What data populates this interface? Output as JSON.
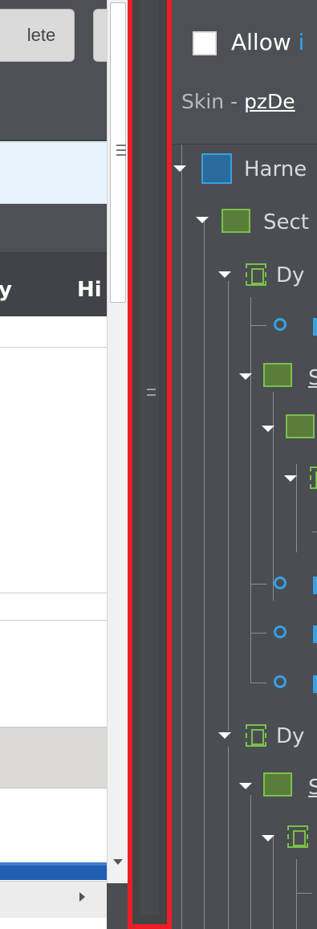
{
  "left_pane": {
    "toolbar": {
      "delete_button_label": "lete",
      "second_button_label": ""
    },
    "tabs": [
      {
        "label": "y"
      },
      {
        "label": "Hi"
      }
    ]
  },
  "splitter": {
    "grip_glyph": "="
  },
  "right_pane": {
    "allow_checkbox": {
      "checked": false,
      "label_visible": "Allow ",
      "label_highlight": "i"
    },
    "skin": {
      "label": "Skin - ",
      "link_text": "pzDe"
    },
    "tree": [
      {
        "label": "Harne",
        "icon": "harness-icon",
        "underlined": false
      },
      {
        "label": "Sect",
        "icon": "section-icon",
        "underlined": false
      },
      {
        "label": "Dy",
        "icon": "dynamic-layout-icon",
        "underlined": false
      },
      {
        "label": "",
        "icon": "circle-icon"
      },
      {
        "label": "S",
        "icon": "section-icon",
        "underlined": true
      },
      {
        "label": "",
        "icon": "section-icon"
      },
      {
        "label": "",
        "icon": "dynamic-layout-icon"
      },
      {
        "label": "",
        "icon": "circle-icon"
      },
      {
        "label": "",
        "icon": "circle-icon"
      },
      {
        "label": "",
        "icon": "circle-icon"
      },
      {
        "label": "Dy",
        "icon": "dynamic-layout-icon",
        "underlined": false
      },
      {
        "label": "S",
        "icon": "section-icon",
        "underlined": true
      },
      {
        "label": "",
        "icon": "dynamic-layout-icon"
      }
    ]
  },
  "colors": {
    "splitter_highlight": "#ee1c25",
    "accent_blue": "#3aa0e0",
    "section_green": "#7cc04a",
    "panel_dark": "#4a4d52"
  }
}
